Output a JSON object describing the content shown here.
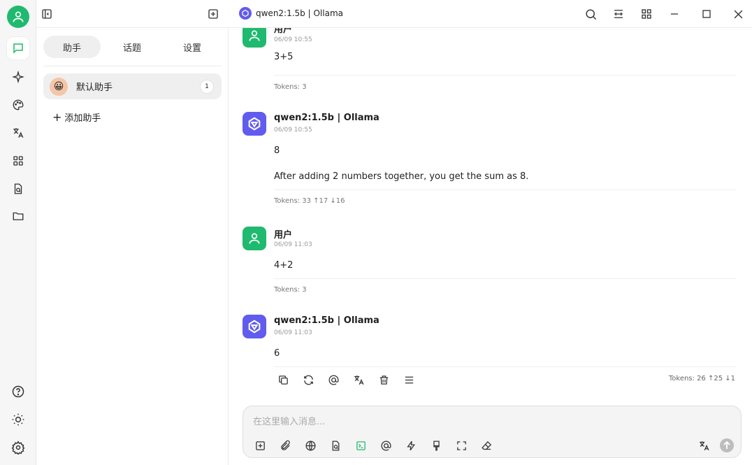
{
  "window": {
    "title": "qwen2:1.5b | Ollama"
  },
  "panel": {
    "tabs": [
      {
        "label": "助手",
        "active": true
      },
      {
        "label": "话题",
        "active": false
      },
      {
        "label": "设置",
        "active": false
      }
    ],
    "assistant": {
      "name": "默认助手",
      "emoji": "😀",
      "count": "1"
    },
    "add_label": "添加助手",
    "add_symbol": "+"
  },
  "messages": [
    {
      "role": "user",
      "name": "用户",
      "time": "06/09 10:55",
      "lines": [
        "3+5"
      ],
      "tokens": "Tokens: 3"
    },
    {
      "role": "bot",
      "name": "qwen2:1.5b | Ollama",
      "time": "06/09 10:55",
      "lines": [
        "8",
        "After adding 2 numbers together, you get the sum as 8."
      ],
      "tokens": "Tokens: 33 ↑17 ↓16"
    },
    {
      "role": "user",
      "name": "用户",
      "time": "06/09 11:03",
      "lines": [
        "4+2"
      ],
      "tokens": "Tokens: 3"
    },
    {
      "role": "bot",
      "name": "qwen2:1.5b | Ollama",
      "time": "06/09 11:03",
      "lines": [
        "6"
      ],
      "tokens": "Tokens: 26 ↑25 ↓1"
    }
  ],
  "input": {
    "placeholder": "在这里输入消息..."
  },
  "icons": {
    "rail": [
      "user-avatar-icon",
      "chat-icon",
      "sparkle-icon",
      "palette-icon",
      "translate-icon",
      "apps-grid-icon",
      "file-search-icon",
      "folder-icon",
      "help-icon",
      "sun-icon",
      "gear-icon"
    ],
    "header": [
      "sidebar-toggle-icon",
      "new-topic-icon",
      "search-icon",
      "layout-icon",
      "grid-icon",
      "minimize-icon",
      "maximize-icon",
      "close-icon"
    ],
    "message_actions": [
      "copy-icon",
      "regenerate-icon",
      "mention-icon",
      "translate-icon",
      "delete-icon",
      "menu-icon"
    ],
    "input_tools": [
      "new-topic-icon",
      "attachment-icon",
      "web-search-icon",
      "knowledge-icon",
      "terminal-icon",
      "mention-icon",
      "lightning-icon",
      "brush-icon",
      "fullscreen-icon",
      "eraser-icon",
      "translate-icon",
      "send-icon"
    ]
  },
  "colors": {
    "accent_green": "#1fba6f",
    "model_purple": "#615ced"
  }
}
